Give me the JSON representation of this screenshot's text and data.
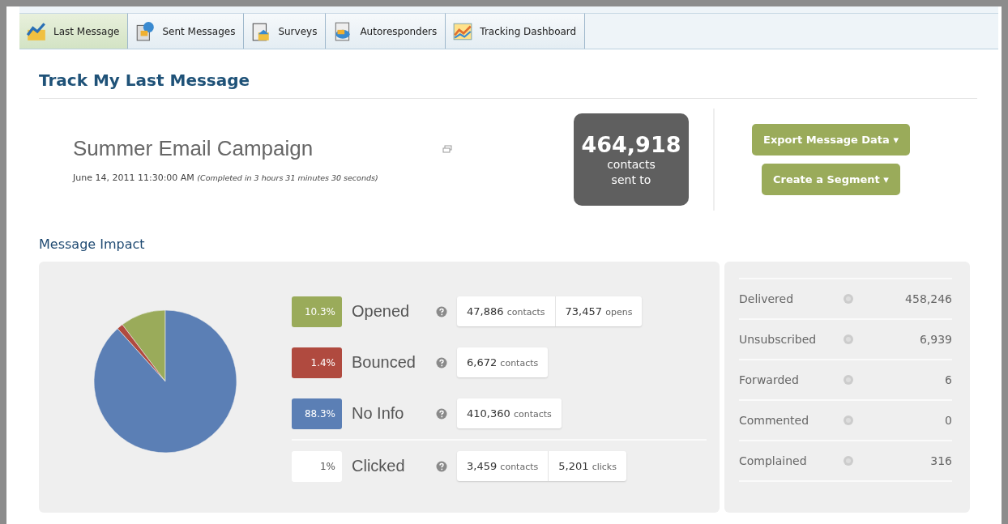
{
  "tabs": [
    {
      "label": "Last Message",
      "selected": true
    },
    {
      "label": "Sent Messages",
      "selected": false
    },
    {
      "label": "Surveys",
      "selected": false
    },
    {
      "label": "Autoresponders",
      "selected": false
    },
    {
      "label": "Tracking Dashboard",
      "selected": false
    }
  ],
  "page_title": "Track My Last Message",
  "campaign": {
    "name": "Summer Email Campaign",
    "date": "June 14, 2011 11:30:00 AM",
    "completed": "(Completed in 3 hours 31 minutes 30 seconds)"
  },
  "sent": {
    "count": "464,918",
    "label": "contacts sent to"
  },
  "buttons": [
    {
      "label": "Export Message Data",
      "caret": "▾"
    },
    {
      "label": "Create a Segment",
      "caret": "▾"
    }
  ],
  "impact": {
    "title": "Message Impact",
    "chart_data": {
      "type": "pie",
      "values": [
        10.3,
        1.4,
        88.3
      ],
      "colors": [
        "#9aab5a",
        "#b04a3f",
        "#5b7fb5"
      ]
    },
    "rows": [
      {
        "percent": "10.3%",
        "color": "#9aab5a",
        "label": "Opened",
        "chips": [
          {
            "value": "47,886",
            "unit": "contacts"
          },
          {
            "value": "73,457",
            "unit": "opens"
          }
        ]
      },
      {
        "percent": "1.4%",
        "color": "#b04a3f",
        "label": "Bounced",
        "chips": [
          {
            "value": "6,672",
            "unit": "contacts"
          }
        ]
      },
      {
        "percent": "88.3%",
        "color": "#5b7fb5",
        "label": "No Info",
        "chips": [
          {
            "value": "410,360",
            "unit": "contacts"
          }
        ]
      },
      {
        "percent": "1%",
        "color": "#ffffff",
        "label": "Clicked",
        "chips": [
          {
            "value": "3,459",
            "unit": "contacts"
          },
          {
            "value": "5,201",
            "unit": "clicks"
          }
        ]
      }
    ]
  },
  "stats": [
    {
      "label": "Delivered",
      "value": "458,246"
    },
    {
      "label": "Unsubscribed",
      "value": "6,939"
    },
    {
      "label": "Forwarded",
      "value": "6"
    },
    {
      "label": "Commented",
      "value": "0"
    },
    {
      "label": "Complained",
      "value": "316"
    }
  ]
}
